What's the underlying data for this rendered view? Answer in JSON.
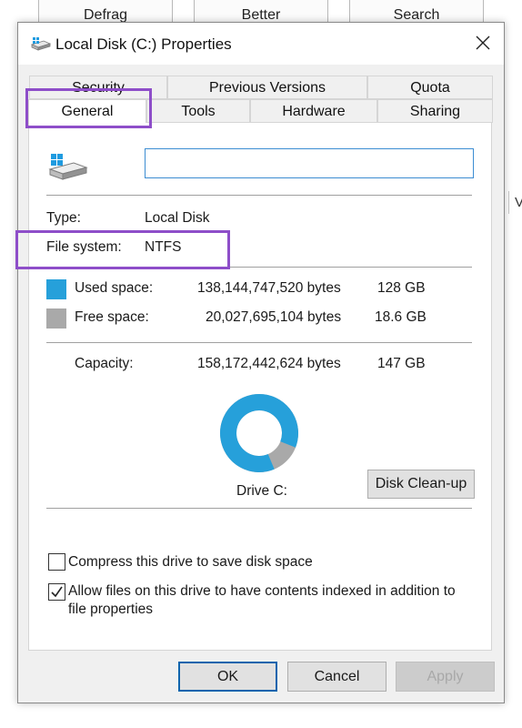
{
  "background_buttons": [
    "Defrag",
    "Better",
    "Search"
  ],
  "background_side_text": "V",
  "dialog": {
    "title": "Local Disk (C:) Properties",
    "tabs_row1": [
      "Security",
      "Previous Versions",
      "Quota"
    ],
    "tabs_row2": [
      "General",
      "Tools",
      "Hardware",
      "Sharing"
    ],
    "active_tab": "General",
    "drive_name_value": "",
    "info": {
      "type_label": "Type:",
      "type_value": "Local Disk",
      "fs_label": "File system:",
      "fs_value": "NTFS"
    },
    "space": {
      "used_label": "Used space:",
      "used_bytes": "138,144,747,520 bytes",
      "used_size": "128 GB",
      "free_label": "Free space:",
      "free_bytes": "20,027,695,104 bytes",
      "free_size": "18.6 GB",
      "capacity_label": "Capacity:",
      "capacity_bytes": "158,172,442,624 bytes",
      "capacity_size": "147 GB",
      "used_fraction": 0.873,
      "used_color": "#26a0da",
      "free_color": "#a9a9a9"
    },
    "drive_caption": "Drive C:",
    "cleanup_label": "Disk Clean-up",
    "options": {
      "compress_label": "Compress this drive to save disk space",
      "compress_checked": false,
      "index_label_line1": "Allow files on this drive to have contents indexed in addition to",
      "index_label_line2": "file properties",
      "index_checked": true
    },
    "buttons": {
      "ok": "OK",
      "cancel": "Cancel",
      "apply": "Apply"
    },
    "highlight_color": "#8e4ec9"
  }
}
